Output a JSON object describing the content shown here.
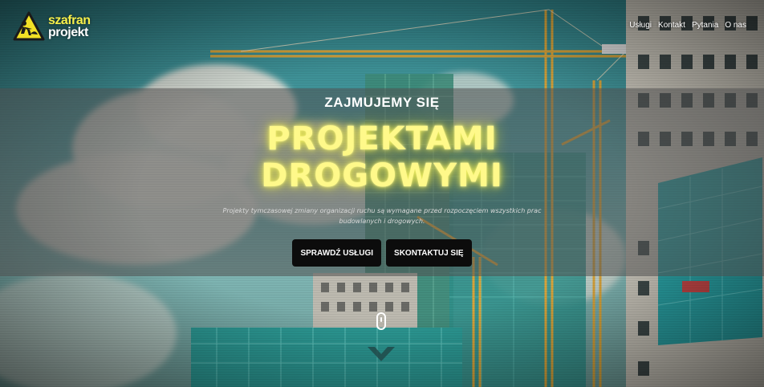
{
  "logo": {
    "line1": "szafran",
    "line2": "projekt"
  },
  "nav": {
    "items": [
      "Usługi",
      "Kontakt",
      "Pytania",
      "O nas"
    ]
  },
  "hero": {
    "kicker": "ZAJMUJEMY SIĘ",
    "title_line1": "PROJEKTAMI",
    "title_line2": "DROGOWYMI",
    "description": "Projekty tymczasowej zmiany organizacji ruchu są wymagane przed rozpoczęciem wszystkich prac budowlanych i drogowych.",
    "button_services": "SPRAWDŹ USŁUGI",
    "button_contact": "SKONTAKTUJ SIĘ"
  },
  "colors": {
    "accent_yellow": "#fff98a",
    "button_bg": "#0c0c0c",
    "band": "#505050"
  },
  "icons": {
    "logo": "road-worker-icon",
    "scroll": "mouse-scroll-icon",
    "chevron": "chevron-down-icon"
  }
}
